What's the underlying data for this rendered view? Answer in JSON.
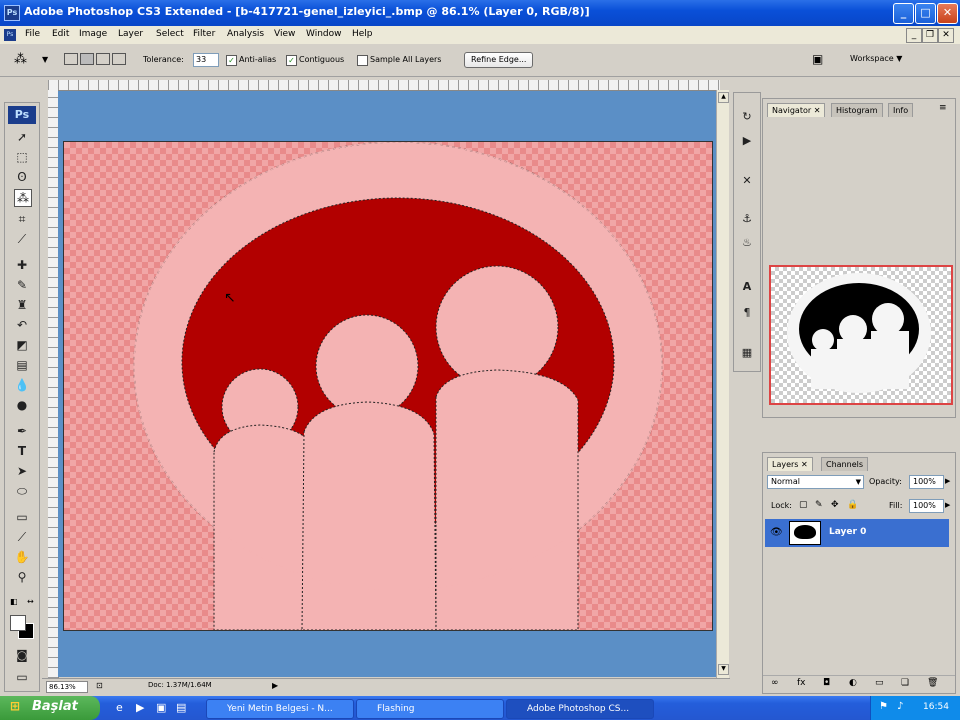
{
  "window": {
    "title": "Adobe Photoshop CS3 Extended - [b-417721-genel_izleyici_.bmp @ 86.1% (Layer 0, RGB/8)]"
  },
  "menubar": {
    "items": [
      "File",
      "Edit",
      "Image",
      "Layer",
      "Select",
      "Filter",
      "Analysis",
      "View",
      "Window",
      "Help"
    ]
  },
  "options": {
    "tolerance_label": "Tolerance:",
    "tolerance_value": "33",
    "anti_alias": "Anti-alias",
    "contiguous": "Contiguous",
    "sample_all_layers": "Sample All Layers",
    "refine_edge": "Refine Edge...",
    "workspace": "Workspace ▼"
  },
  "tools": {
    "logo": "Ps"
  },
  "canvas": {
    "colors": {
      "pasteboard": "#5b8fc6",
      "checker": "#f1a6a6",
      "circle": "#f4b3b3",
      "selection": "#b20000"
    }
  },
  "statusbar": {
    "zoom": "86.13%",
    "doc": "Doc: 1.37M/1.64M"
  },
  "navigator": {
    "tabs": [
      "Navigator",
      "Histogram",
      "Info"
    ]
  },
  "layers": {
    "tabs": [
      "Layers",
      "Channels"
    ],
    "blend_mode": "Normal",
    "opacity_label": "Opacity:",
    "opacity_value": "100%",
    "lock_label": "Lock:",
    "fill_label": "Fill:",
    "fill_value": "100%",
    "layer_name": "Layer 0"
  },
  "taskbar": {
    "start": "Başlat",
    "tasks": [
      "Yeni Metin Belgesi - N...",
      "Flashing",
      "Adobe Photoshop CS..."
    ],
    "clock": "16:54"
  }
}
